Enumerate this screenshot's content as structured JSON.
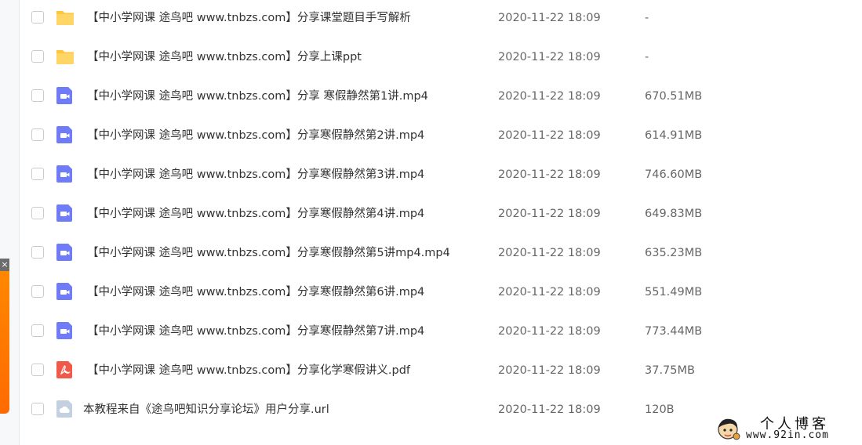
{
  "files": [
    {
      "icon": "folder-icon",
      "name": "【中小学网课 途鸟吧 www.tnbzs.com】分享课堂题目手写解析",
      "date": "2020-11-22 18:09",
      "size": "-"
    },
    {
      "icon": "folder-icon",
      "name": "【中小学网课 途鸟吧 www.tnbzs.com】分享上课ppt",
      "date": "2020-11-22 18:09",
      "size": "-"
    },
    {
      "icon": "video-file-icon",
      "name": "【中小学网课 途鸟吧 www.tnbzs.com】分享 寒假静然第1讲.mp4",
      "date": "2020-11-22 18:09",
      "size": "670.51MB"
    },
    {
      "icon": "video-file-icon",
      "name": "【中小学网课 途鸟吧 www.tnbzs.com】分享寒假静然第2讲.mp4",
      "date": "2020-11-22 18:09",
      "size": "614.91MB"
    },
    {
      "icon": "video-file-icon",
      "name": "【中小学网课 途鸟吧 www.tnbzs.com】分享寒假静然第3讲.mp4",
      "date": "2020-11-22 18:09",
      "size": "746.60MB"
    },
    {
      "icon": "video-file-icon",
      "name": "【中小学网课 途鸟吧 www.tnbzs.com】分享寒假静然第4讲.mp4",
      "date": "2020-11-22 18:09",
      "size": "649.83MB"
    },
    {
      "icon": "video-file-icon",
      "name": "【中小学网课 途鸟吧 www.tnbzs.com】分享寒假静然第5讲mp4.mp4",
      "date": "2020-11-22 18:09",
      "size": "635.23MB"
    },
    {
      "icon": "video-file-icon",
      "name": "【中小学网课 途鸟吧 www.tnbzs.com】分享寒假静然第6讲.mp4",
      "date": "2020-11-22 18:09",
      "size": "551.49MB"
    },
    {
      "icon": "video-file-icon",
      "name": "【中小学网课 途鸟吧 www.tnbzs.com】分享寒假静然第7讲.mp4",
      "date": "2020-11-22 18:09",
      "size": "773.44MB"
    },
    {
      "icon": "pdf-file-icon",
      "name": "【中小学网课 途鸟吧 www.tnbzs.com】分享化学寒假讲义.pdf",
      "date": "2020-11-22 18:09",
      "size": "37.75MB"
    },
    {
      "icon": "cloud-file-icon",
      "name": "本教程来自《途鸟吧知识分享论坛》用户分享.url",
      "date": "2020-11-22 18:09",
      "size": "120B"
    }
  ],
  "float_ad": {
    "close_label": "×"
  },
  "watermark": {
    "title": "个人博客",
    "url": "www.92in.com"
  },
  "colors": {
    "folder": "#ffc53d",
    "video": "#6f7bf7",
    "pdf": "#f15a4a",
    "cloud": "#c2d0e0"
  }
}
